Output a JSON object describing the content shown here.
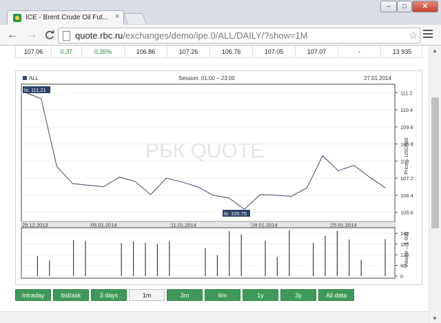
{
  "browser": {
    "tab_title": "ICE - Brent Crude Oil Fut...",
    "tab_close": "×",
    "win_min": "–",
    "win_max": "□",
    "win_close": "✕",
    "url_host": "quote.rbc.ru",
    "url_path": "/exchanges/demo/ipe.0/ALL/DAILY/?show=1M",
    "back_icon": "←",
    "forward_icon": "→",
    "reload_icon": "C",
    "star_icon": "☆"
  },
  "quote_row": [
    "107.06",
    "0.37",
    "0.35%",
    "106.86",
    "107.26",
    "106.76",
    "107.05",
    "107.07",
    "-",
    "13 935"
  ],
  "chart": {
    "series_label": "ALL",
    "session": "Session: 01:00 – 23:00",
    "date": "27.01.2014",
    "watermark": "РБК QUOTE",
    "price_axis_label": "Price – USD/bbl",
    "volume_axis_label": "Volume – 1 000",
    "hi_label": "hi: 111.21",
    "lo_label": "lo: 105.75"
  },
  "chart_data": {
    "type": "line",
    "x_ticks": [
      "29.12.2013",
      "05.01.2014",
      "11.01.2014",
      "18.01.2014",
      "25.01.2014"
    ],
    "price": [
      111.21,
      110.92,
      107.75,
      106.95,
      106.87,
      106.8,
      107.25,
      107.05,
      106.43,
      107.2,
      107.02,
      106.8,
      106.4,
      106.28,
      105.75,
      106.43,
      106.4,
      106.35,
      106.75,
      108.25,
      107.55,
      107.8,
      107.25,
      106.75
    ],
    "price_ylim": [
      105.3,
      111.5
    ],
    "price_ticks": [
      "111.2",
      "110.4",
      "109.6",
      "108.8",
      "108",
      "107.2",
      "106.4",
      "105.6"
    ],
    "volume_x": [
      1,
      2,
      4,
      5,
      8,
      9,
      10,
      11,
      12,
      15,
      16,
      17,
      18,
      20,
      21,
      22,
      24,
      25,
      26,
      27,
      28,
      30
    ],
    "volume": [
      113,
      88,
      202,
      198,
      185,
      195,
      188,
      182,
      198,
      157,
      118,
      253,
      234,
      200,
      107,
      258,
      188,
      228,
      254,
      205,
      90,
      208
    ],
    "volume_ylim": [
      0,
      260
    ],
    "volume_ticks": [
      "240",
      "180",
      "120",
      "60",
      "0"
    ]
  },
  "range_buttons": [
    "Intraday",
    "bid/ask",
    "3 days",
    "1m",
    "3m",
    "6m",
    "1y",
    "3y",
    "All data"
  ],
  "active_range": "1m"
}
